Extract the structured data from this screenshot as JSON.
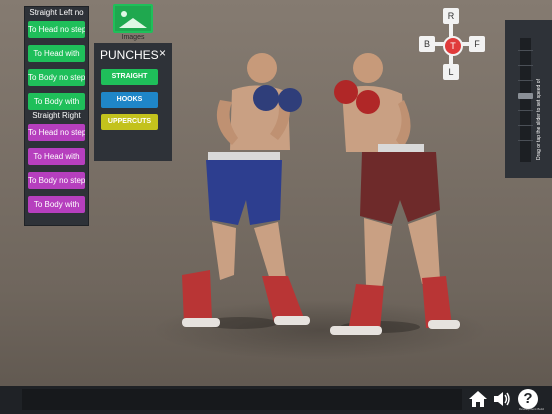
{
  "left_panel": {
    "left_header": "Straight Left no",
    "left_items": [
      "To Head no step",
      "To Head with",
      "To Body no step",
      "To Body with"
    ],
    "right_header": "Straight Right",
    "right_items": [
      "To Head no step",
      "To Head with",
      "To Body no step",
      "To Body with"
    ]
  },
  "images_label": "Images",
  "punches_menu": {
    "title": "PUNCHES",
    "close": "×",
    "buttons": [
      {
        "label": "STRAIGHT",
        "color": "#1fbf5a"
      },
      {
        "label": "HOOKS",
        "color": "#1f86c8"
      },
      {
        "label": "UPPERCUTS",
        "color": "#c3c21d"
      }
    ]
  },
  "camera": {
    "top": "R",
    "left": "B",
    "center": "T",
    "right": "F",
    "bottom": "L"
  },
  "speed": {
    "hint": "Drag or tap the slider to set speed of",
    "value": 0.55
  },
  "bottom_bar": {
    "dev_label": "Development Build"
  },
  "colors": {
    "accent_green": "#1fbf5a",
    "accent_magenta": "#b63fbe",
    "panel": "#2e3238"
  }
}
